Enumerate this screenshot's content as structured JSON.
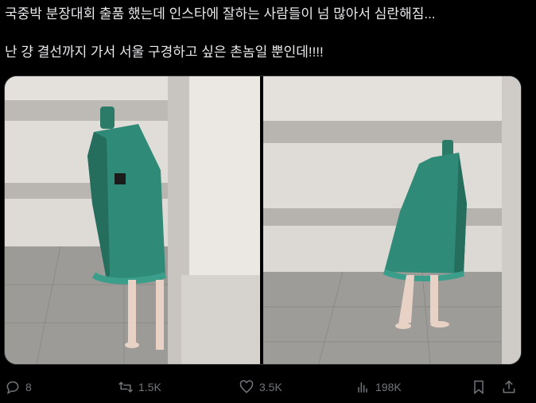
{
  "post": {
    "line1": "국중박 분장대회 출품 했는데 인스타에 잘하는 사람들이 넘 많아서 심란해짐...",
    "line2": "난 걍 결선까지 가서 서울 구경하고 싶은 촌놈일 뿐인데!!!!"
  },
  "actions": {
    "replies": "8",
    "reposts": "1.5K",
    "likes": "3.5K",
    "views": "198K"
  },
  "icons": {
    "reply": "reply-icon",
    "repost": "repost-icon",
    "like": "heart-icon",
    "views": "views-bar-chart-icon",
    "bookmark": "bookmark-icon",
    "share": "share-icon"
  },
  "colors": {
    "background": "#000000",
    "text": "#e7e9ea",
    "muted": "#71767b",
    "costume_green": "#2f8a77"
  }
}
